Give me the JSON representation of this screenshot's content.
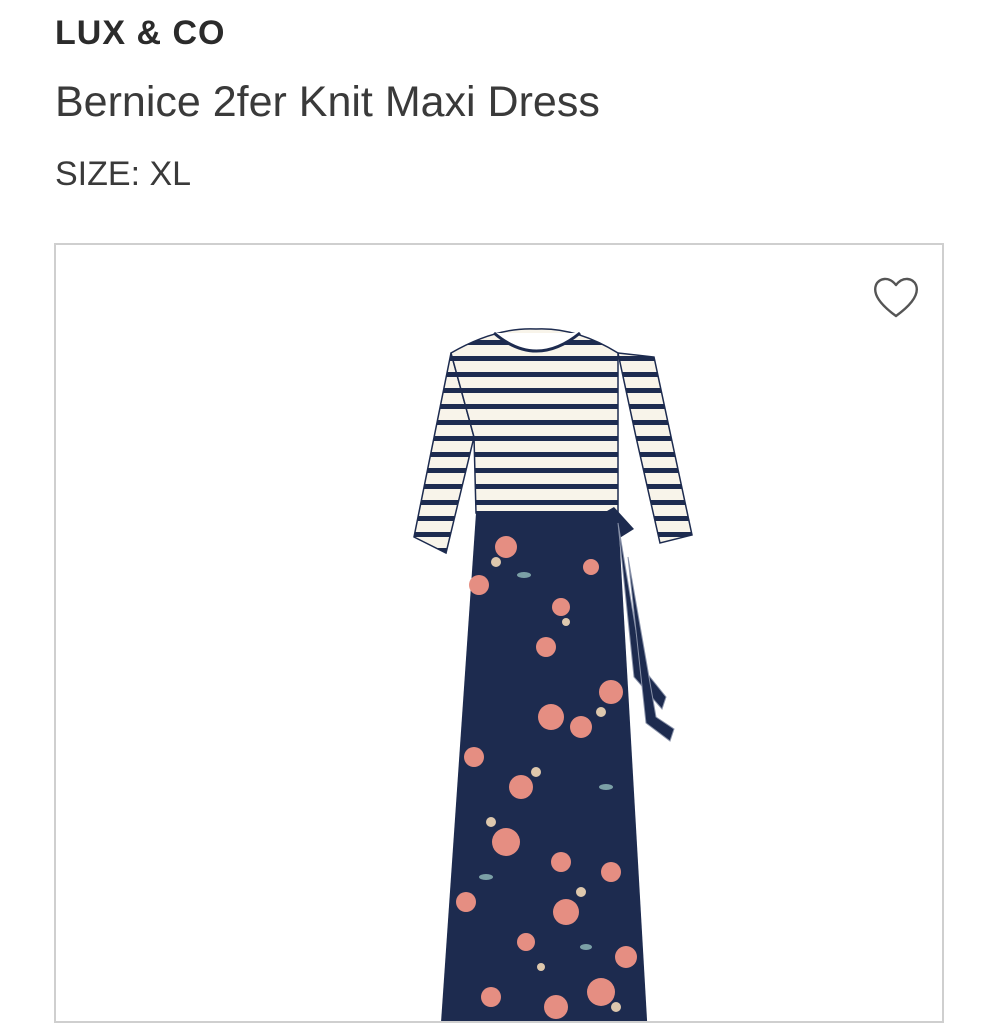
{
  "product": {
    "brand": "LUX & CO",
    "name": "Bernice 2fer Knit Maxi Dress",
    "size": "SIZE: XL"
  },
  "favorite": {
    "icon": "heart-outline-icon"
  },
  "colors": {
    "navy": "#1d2b4f",
    "cream": "#f8f4ea",
    "rose": "#e58e82",
    "card_border": "#cfcfcf"
  }
}
